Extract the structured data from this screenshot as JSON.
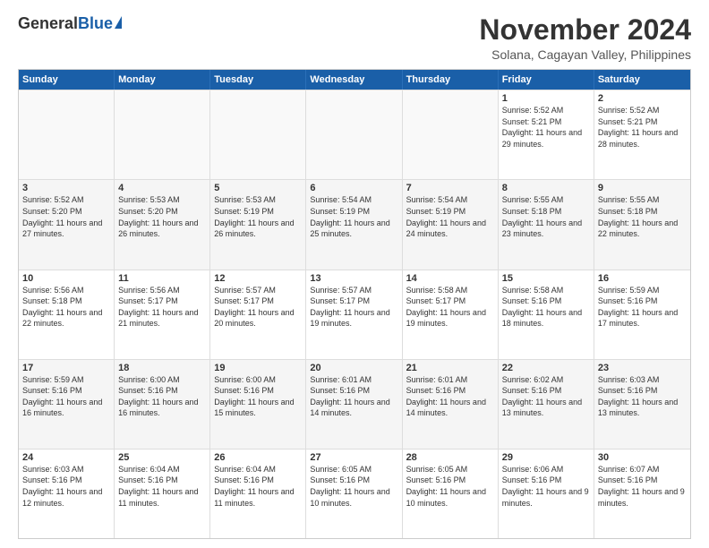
{
  "logo": {
    "general": "General",
    "blue": "Blue"
  },
  "title": "November 2024",
  "location": "Solana, Cagayan Valley, Philippines",
  "header_days": [
    "Sunday",
    "Monday",
    "Tuesday",
    "Wednesday",
    "Thursday",
    "Friday",
    "Saturday"
  ],
  "rows": [
    [
      {
        "day": "",
        "info": "",
        "empty": true
      },
      {
        "day": "",
        "info": "",
        "empty": true
      },
      {
        "day": "",
        "info": "",
        "empty": true
      },
      {
        "day": "",
        "info": "",
        "empty": true
      },
      {
        "day": "",
        "info": "",
        "empty": true
      },
      {
        "day": "1",
        "info": "Sunrise: 5:52 AM\nSunset: 5:21 PM\nDaylight: 11 hours\nand 29 minutes."
      },
      {
        "day": "2",
        "info": "Sunrise: 5:52 AM\nSunset: 5:21 PM\nDaylight: 11 hours\nand 28 minutes."
      }
    ],
    [
      {
        "day": "3",
        "info": "Sunrise: 5:52 AM\nSunset: 5:20 PM\nDaylight: 11 hours\nand 27 minutes."
      },
      {
        "day": "4",
        "info": "Sunrise: 5:53 AM\nSunset: 5:20 PM\nDaylight: 11 hours\nand 26 minutes."
      },
      {
        "day": "5",
        "info": "Sunrise: 5:53 AM\nSunset: 5:19 PM\nDaylight: 11 hours\nand 26 minutes."
      },
      {
        "day": "6",
        "info": "Sunrise: 5:54 AM\nSunset: 5:19 PM\nDaylight: 11 hours\nand 25 minutes."
      },
      {
        "day": "7",
        "info": "Sunrise: 5:54 AM\nSunset: 5:19 PM\nDaylight: 11 hours\nand 24 minutes."
      },
      {
        "day": "8",
        "info": "Sunrise: 5:55 AM\nSunset: 5:18 PM\nDaylight: 11 hours\nand 23 minutes."
      },
      {
        "day": "9",
        "info": "Sunrise: 5:55 AM\nSunset: 5:18 PM\nDaylight: 11 hours\nand 22 minutes."
      }
    ],
    [
      {
        "day": "10",
        "info": "Sunrise: 5:56 AM\nSunset: 5:18 PM\nDaylight: 11 hours\nand 22 minutes."
      },
      {
        "day": "11",
        "info": "Sunrise: 5:56 AM\nSunset: 5:17 PM\nDaylight: 11 hours\nand 21 minutes."
      },
      {
        "day": "12",
        "info": "Sunrise: 5:57 AM\nSunset: 5:17 PM\nDaylight: 11 hours\nand 20 minutes."
      },
      {
        "day": "13",
        "info": "Sunrise: 5:57 AM\nSunset: 5:17 PM\nDaylight: 11 hours\nand 19 minutes."
      },
      {
        "day": "14",
        "info": "Sunrise: 5:58 AM\nSunset: 5:17 PM\nDaylight: 11 hours\nand 19 minutes."
      },
      {
        "day": "15",
        "info": "Sunrise: 5:58 AM\nSunset: 5:16 PM\nDaylight: 11 hours\nand 18 minutes."
      },
      {
        "day": "16",
        "info": "Sunrise: 5:59 AM\nSunset: 5:16 PM\nDaylight: 11 hours\nand 17 minutes."
      }
    ],
    [
      {
        "day": "17",
        "info": "Sunrise: 5:59 AM\nSunset: 5:16 PM\nDaylight: 11 hours\nand 16 minutes."
      },
      {
        "day": "18",
        "info": "Sunrise: 6:00 AM\nSunset: 5:16 PM\nDaylight: 11 hours\nand 16 minutes."
      },
      {
        "day": "19",
        "info": "Sunrise: 6:00 AM\nSunset: 5:16 PM\nDaylight: 11 hours\nand 15 minutes."
      },
      {
        "day": "20",
        "info": "Sunrise: 6:01 AM\nSunset: 5:16 PM\nDaylight: 11 hours\nand 14 minutes."
      },
      {
        "day": "21",
        "info": "Sunrise: 6:01 AM\nSunset: 5:16 PM\nDaylight: 11 hours\nand 14 minutes."
      },
      {
        "day": "22",
        "info": "Sunrise: 6:02 AM\nSunset: 5:16 PM\nDaylight: 11 hours\nand 13 minutes."
      },
      {
        "day": "23",
        "info": "Sunrise: 6:03 AM\nSunset: 5:16 PM\nDaylight: 11 hours\nand 13 minutes."
      }
    ],
    [
      {
        "day": "24",
        "info": "Sunrise: 6:03 AM\nSunset: 5:16 PM\nDaylight: 11 hours\nand 12 minutes."
      },
      {
        "day": "25",
        "info": "Sunrise: 6:04 AM\nSunset: 5:16 PM\nDaylight: 11 hours\nand 11 minutes."
      },
      {
        "day": "26",
        "info": "Sunrise: 6:04 AM\nSunset: 5:16 PM\nDaylight: 11 hours\nand 11 minutes."
      },
      {
        "day": "27",
        "info": "Sunrise: 6:05 AM\nSunset: 5:16 PM\nDaylight: 11 hours\nand 10 minutes."
      },
      {
        "day": "28",
        "info": "Sunrise: 6:05 AM\nSunset: 5:16 PM\nDaylight: 11 hours\nand 10 minutes."
      },
      {
        "day": "29",
        "info": "Sunrise: 6:06 AM\nSunset: 5:16 PM\nDaylight: 11 hours\nand 9 minutes."
      },
      {
        "day": "30",
        "info": "Sunrise: 6:07 AM\nSunset: 5:16 PM\nDaylight: 11 hours\nand 9 minutes."
      }
    ]
  ]
}
